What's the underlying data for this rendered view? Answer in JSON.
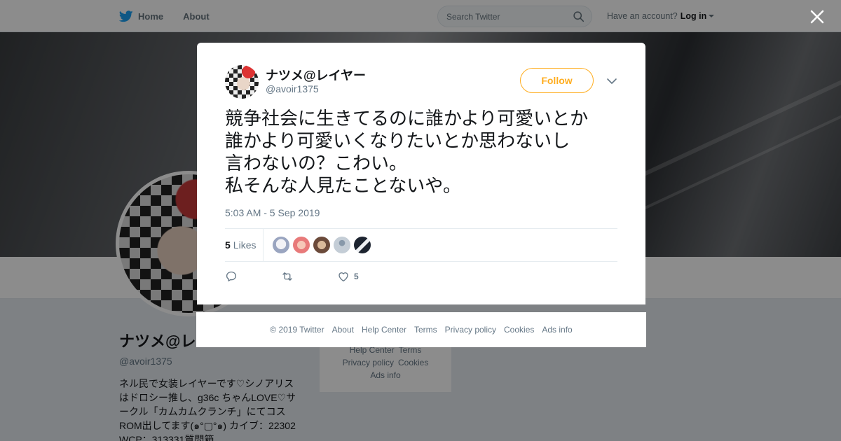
{
  "topbar": {
    "home_label": "Home",
    "about_label": "About",
    "search_placeholder": "Search Twitter",
    "account_prompt": "Have an account?",
    "login_label": "Log in"
  },
  "profile": {
    "name": "ナツメ@レ",
    "handle": "@avoir1375",
    "bio": "ネル民で女装レイヤーです♡シノアリス\nはドロシー推し、g36c ちゃんLOVE♡サ\nークル「カムカムクランチ」にてコス\nROM出してます(๑°▢°๑) カイブ：22302\nWCP：313331質問箱",
    "side_links": [
      "Help Center",
      "Terms",
      "Privacy policy",
      "Cookies",
      "Ads info"
    ]
  },
  "tweet": {
    "author_name": "ナツメ@レイヤー",
    "author_handle": "@avoir1375",
    "follow_label": "Follow",
    "text": "競争社会に生きてるのに誰かより可愛いとか\n誰かより可愛いくなりたいとか思わないし\n言わないの？こわい。\n私そんな人見たことないや。",
    "timestamp": "5:03 AM - 5 Sep 2019",
    "likes_count": "5",
    "likes_label": "Likes",
    "action_like_count": "5"
  },
  "footer": {
    "copyright": "© 2019 Twitter",
    "links": [
      "About",
      "Help Center",
      "Terms",
      "Privacy policy",
      "Cookies",
      "Ads info"
    ]
  },
  "colors": {
    "follow_accent": "#ffad1f",
    "twitter_blue": "#1da1f2",
    "muted_text": "#657786"
  },
  "icons": [
    "twitter-bird-icon",
    "search-icon",
    "close-icon",
    "chevron-down-icon",
    "reply-icon",
    "retweet-icon",
    "heart-icon"
  ]
}
